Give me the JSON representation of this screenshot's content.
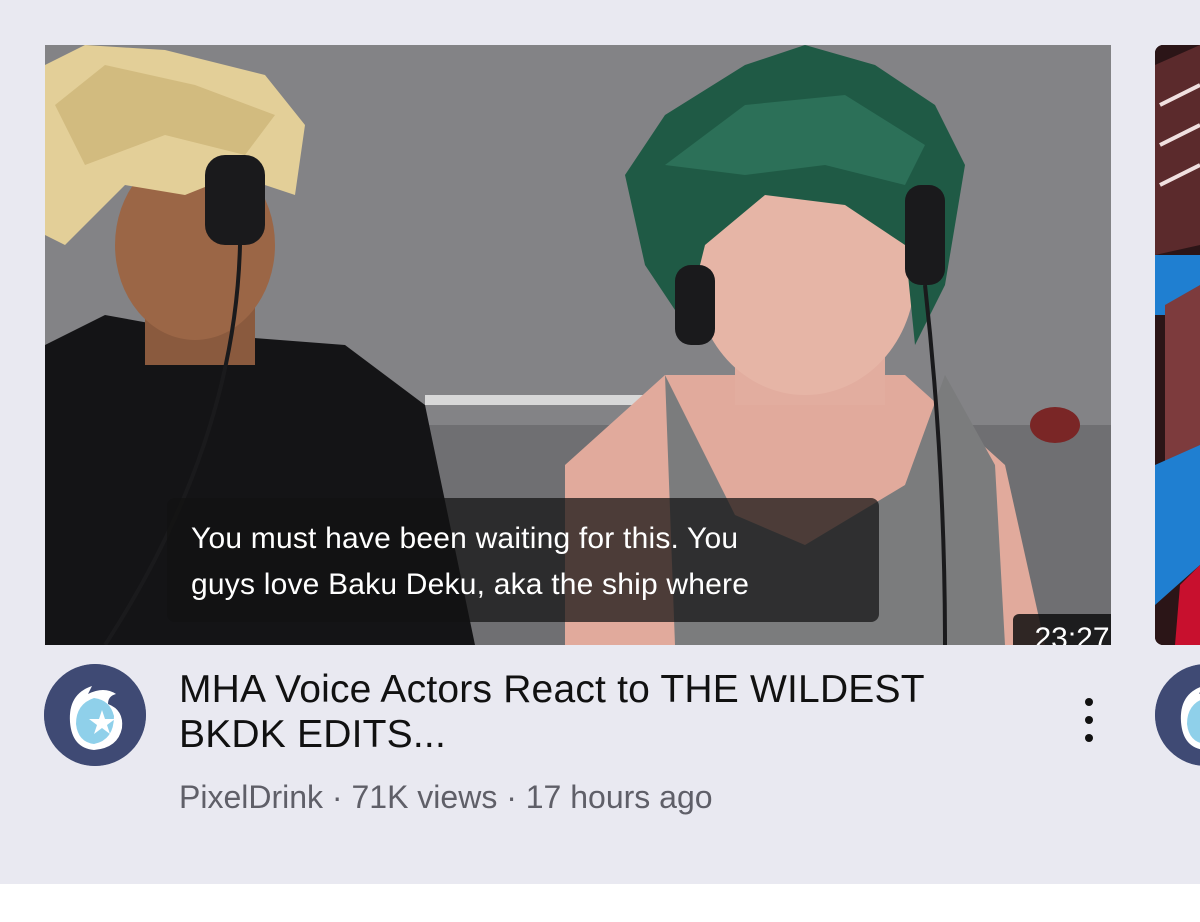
{
  "video": {
    "caption_line1": "You must have been waiting for this. You",
    "caption_line2": "guys love Baku Deku, aka the ship where",
    "duration": "23:27",
    "title": "MHA Voice Actors React to THE WILDEST BKDK EDITS...",
    "channel": "PixelDrink",
    "separator": "·",
    "views": "71K views",
    "age": "17 hours ago"
  },
  "icons": {
    "more": "more-vert-icon",
    "avatar": "channel-avatar-icon"
  },
  "colors": {
    "background": "#e9e9f1",
    "avatar": "#3f4a74",
    "title": "#111111",
    "meta": "#5f5f68"
  }
}
